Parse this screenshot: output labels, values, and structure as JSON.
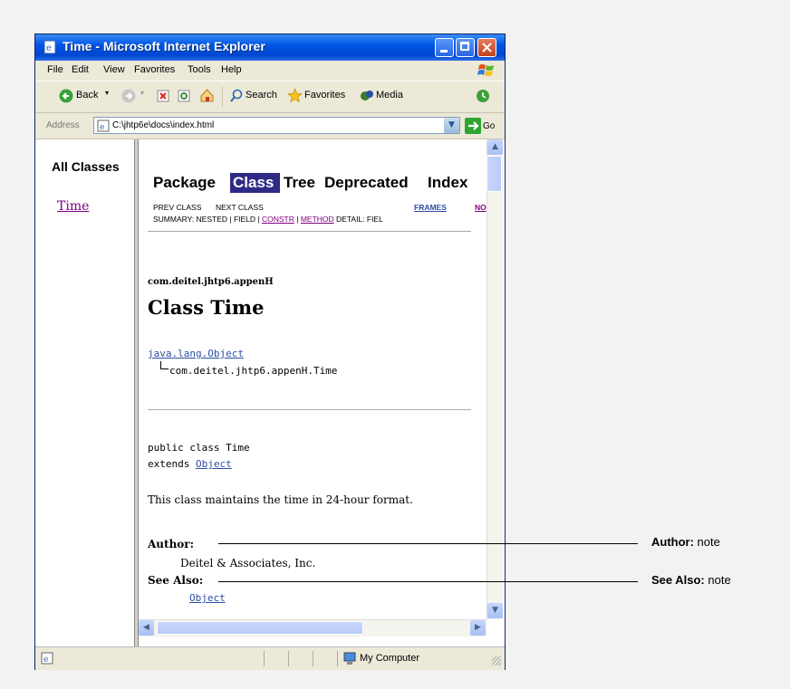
{
  "window": {
    "title": "Time - Microsoft Internet Explorer"
  },
  "menu": [
    "File",
    "Edit",
    "View",
    "Favorites",
    "Tools",
    "Help"
  ],
  "toolbar": {
    "back": "Back",
    "search": "Search",
    "favorites": "Favorites",
    "media": "Media"
  },
  "address": {
    "label": "Address",
    "value": "C:\\jhtp6e\\docs\\index.html",
    "go": "Go"
  },
  "left_frame": {
    "title": "All Classes",
    "classes": [
      "Time"
    ]
  },
  "navbar": {
    "package": "Package",
    "class": "Class",
    "tree": "Tree",
    "deprecated": "Deprecated",
    "index": "Index"
  },
  "subnav": {
    "prev_class": "PREV CLASS",
    "next_class": "NEXT CLASS",
    "frames": "FRAMES",
    "noframes": "NO",
    "summary_prefix": "SUMMARY: NESTED | FIELD | ",
    "constr": "CONSTR",
    "sep": " | ",
    "method": "METHOD",
    "detail": "DETAIL: FIEL"
  },
  "doc": {
    "package": "com.deitel.jhtp6.appenH",
    "class_title": "Class Time",
    "inherit_root": "java.lang.Object",
    "inherit_child": "com.deitel.jhtp6.appenH.Time",
    "decl_line1": "public class Time",
    "decl_extends": "extends ",
    "decl_object": "Object",
    "description": "This class maintains the time in 24-hour format.",
    "author_label": "Author:",
    "author_value": "Deitel & Associates, Inc.",
    "see_also_label": "See Also:",
    "see_also_value": "Object"
  },
  "status": {
    "zone": "My Computer"
  },
  "callouts": {
    "author": {
      "bold": "Author:",
      "rest": " note"
    },
    "see_also": {
      "bold": "See Also:",
      "rest": " note"
    }
  },
  "colors": {
    "title_bar": "#0055e5",
    "nav_highlight": "#2f2a85",
    "visited_link": "#800080",
    "link": "#2b4fa3"
  }
}
